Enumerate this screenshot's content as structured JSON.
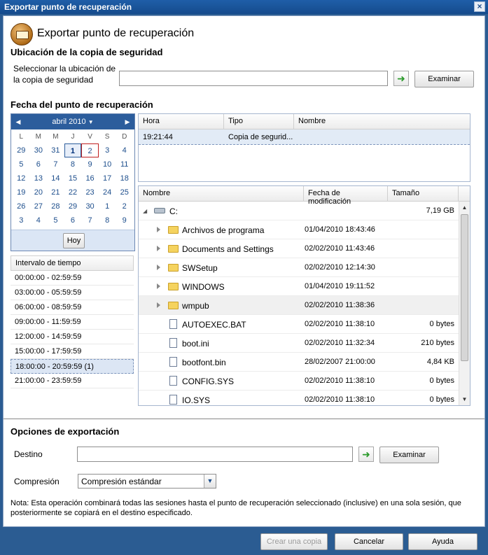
{
  "window": {
    "title": "Exportar punto de recuperación"
  },
  "header": {
    "title": "Exportar punto de recuperación"
  },
  "backup": {
    "section": "Ubicación de la copia de seguridad",
    "label": "Seleccionar la ubicación de la copia de seguridad",
    "value": "",
    "browse": "Examinar"
  },
  "recovery": {
    "section": "Fecha del punto de recuperación"
  },
  "calendar": {
    "month": "abril 2010",
    "dow": [
      "L",
      "M",
      "M",
      "J",
      "V",
      "S",
      "D"
    ],
    "weeks": [
      [
        "29",
        "30",
        "31",
        "1",
        "2",
        "3",
        "4"
      ],
      [
        "5",
        "6",
        "7",
        "8",
        "9",
        "10",
        "11"
      ],
      [
        "12",
        "13",
        "14",
        "15",
        "16",
        "17",
        "18"
      ],
      [
        "19",
        "20",
        "21",
        "22",
        "23",
        "24",
        "25"
      ],
      [
        "26",
        "27",
        "28",
        "29",
        "30",
        "1",
        "2"
      ],
      [
        "3",
        "4",
        "5",
        "6",
        "7",
        "8",
        "9"
      ]
    ],
    "today_button": "Hoy"
  },
  "intervals": {
    "header": "Intervalo de tiempo",
    "items": [
      "00:00:00 - 02:59:59",
      "03:00:00 - 05:59:59",
      "06:00:00 - 08:59:59",
      "09:00:00 - 11:59:59",
      "12:00:00 - 14:59:59",
      "15:00:00 - 17:59:59",
      "18:00:00 - 20:59:59 (1)",
      "21:00:00 - 23:59:59"
    ]
  },
  "sessions": {
    "columns": [
      "Hora",
      "Tipo",
      "Nombre"
    ],
    "rows": [
      {
        "hora": "19:21:44",
        "tipo": "Copia de segurid...",
        "nombre": ""
      }
    ]
  },
  "files": {
    "columns": [
      "Nombre",
      "Fecha de modificación",
      "Tamaño"
    ],
    "drive": {
      "name": "C:",
      "size": "7,19 GB"
    },
    "rows": [
      {
        "name": "Archivos de programa",
        "date": "01/04/2010 18:43:46",
        "size": "",
        "type": "folder"
      },
      {
        "name": "Documents and Settings",
        "date": "02/02/2010 11:43:46",
        "size": "",
        "type": "folder"
      },
      {
        "name": "SWSetup",
        "date": "02/02/2010 12:14:30",
        "size": "",
        "type": "folder"
      },
      {
        "name": "WINDOWS",
        "date": "01/04/2010 19:11:52",
        "size": "",
        "type": "folder"
      },
      {
        "name": "wmpub",
        "date": "02/02/2010 11:38:36",
        "size": "",
        "type": "folder"
      },
      {
        "name": "AUTOEXEC.BAT",
        "date": "02/02/2010 11:38:10",
        "size": "0 bytes",
        "type": "file"
      },
      {
        "name": "boot.ini",
        "date": "02/02/2010 11:32:34",
        "size": "210 bytes",
        "type": "file"
      },
      {
        "name": "bootfont.bin",
        "date": "28/02/2007 21:00:00",
        "size": "4,84 KB",
        "type": "file"
      },
      {
        "name": "CONFIG.SYS",
        "date": "02/02/2010 11:38:10",
        "size": "0 bytes",
        "type": "file"
      },
      {
        "name": "IO.SYS",
        "date": "02/02/2010 11:38:10",
        "size": "0 bytes",
        "type": "file"
      }
    ]
  },
  "export": {
    "section": "Opciones de exportación",
    "dest_label": "Destino",
    "dest_value": "",
    "browse": "Examinar",
    "compression_label": "Compresión",
    "compression_value": "Compresión estándar",
    "note": "Nota: Esta operación combinará todas las sesiones hasta el punto de recuperación seleccionado (inclusive) en una sola sesión, que posteriormente se copiará en el destino especificado."
  },
  "footer": {
    "create": "Crear una copia",
    "cancel": "Cancelar",
    "help": "Ayuda"
  },
  "icons": {
    "go": "arrow-right-icon",
    "prev": "triangle-left-icon",
    "next": "triangle-right-icon"
  }
}
